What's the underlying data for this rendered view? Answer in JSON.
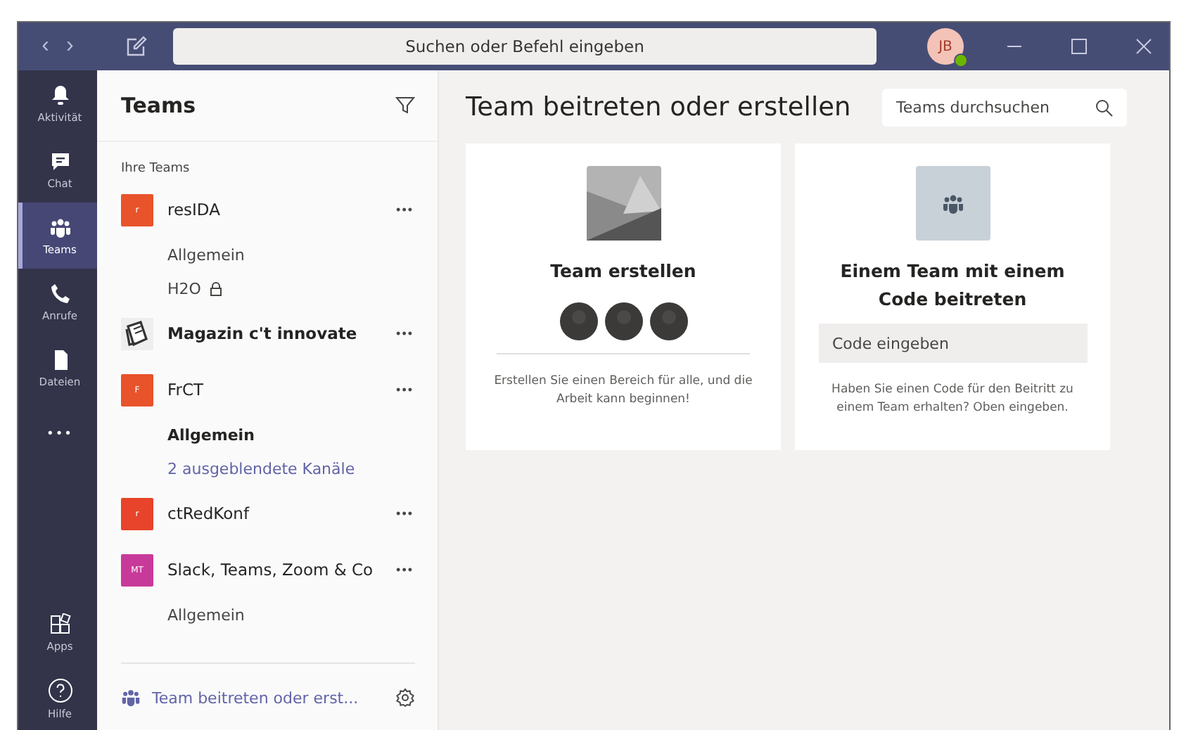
{
  "titlebar": {
    "back": "‹",
    "forward": "›",
    "search_placeholder": "Suchen oder Befehl eingeben",
    "avatar": "JB"
  },
  "rail": [
    {
      "label": "Aktivität",
      "kind": "bell",
      "selected": false
    },
    {
      "label": "Chat",
      "kind": "chat",
      "selected": false
    },
    {
      "label": "Teams",
      "kind": "teams",
      "selected": true
    },
    {
      "label": "Anrufe",
      "kind": "phone",
      "selected": false
    },
    {
      "label": "Dateien",
      "kind": "file",
      "selected": false
    },
    {
      "label": "•••",
      "kind": "more",
      "selected": false
    }
  ],
  "rail_bottom": [
    {
      "label": "Apps",
      "kind": "apps",
      "selected": false
    },
    {
      "label": "Hilfe",
      "kind": "help",
      "selected": false
    }
  ],
  "teams_panel": {
    "title": "Teams",
    "section": "Ihre Teams",
    "teams": [
      {
        "name": "resIDA",
        "initials": "r",
        "color": "#e8532b",
        "kind": "tile",
        "bold": false,
        "more": "•••",
        "channels": [
          {
            "name": "Allgemein",
            "kind": "channel",
            "bold": false,
            "locked": false
          },
          {
            "name": "H2O",
            "kind": "channel",
            "bold": false,
            "locked": true
          }
        ]
      },
      {
        "name": "Magazin c't innovate",
        "kind": "book",
        "bold": true,
        "more": "•••"
      },
      {
        "name": "FrCT",
        "initials": "F",
        "color": "#e8532b",
        "kind": "tile",
        "bold": false,
        "more": "•••",
        "channels": [
          {
            "name": "Allgemein",
            "kind": "channel",
            "bold": true,
            "locked": false
          },
          {
            "name": "2 ausgeblendete Kanäle",
            "kind": "hidden"
          }
        ]
      },
      {
        "name": "ctRedKonf",
        "initials": "r",
        "color": "#e8442b",
        "kind": "tile",
        "bold": false,
        "more": "•••"
      },
      {
        "name": "Slack, Teams, Zoom & Co",
        "initials": "MT",
        "color": "#c83a9a",
        "kind": "tile",
        "bold": false,
        "more": "•••",
        "channels": [
          {
            "name": "Allgemein",
            "kind": "channel",
            "bold": false,
            "locked": false
          }
        ]
      }
    ],
    "footer_link": "Team beitreten oder erst..."
  },
  "main": {
    "title": "Team beitreten oder erstellen",
    "search_placeholder": "Teams durchsuchen",
    "cards": [
      {
        "kind": "create",
        "title": "Team erstellen",
        "text": "Erstellen Sie einen Bereich für alle, und die Arbeit kann beginnen!"
      },
      {
        "kind": "code",
        "title": "Einem Team mit einem Code beitreten",
        "placeholder": "Code eingeben",
        "text": "Haben Sie einen Code für den Beitritt zu einem Team erhalten? Oben eingeben."
      }
    ]
  }
}
